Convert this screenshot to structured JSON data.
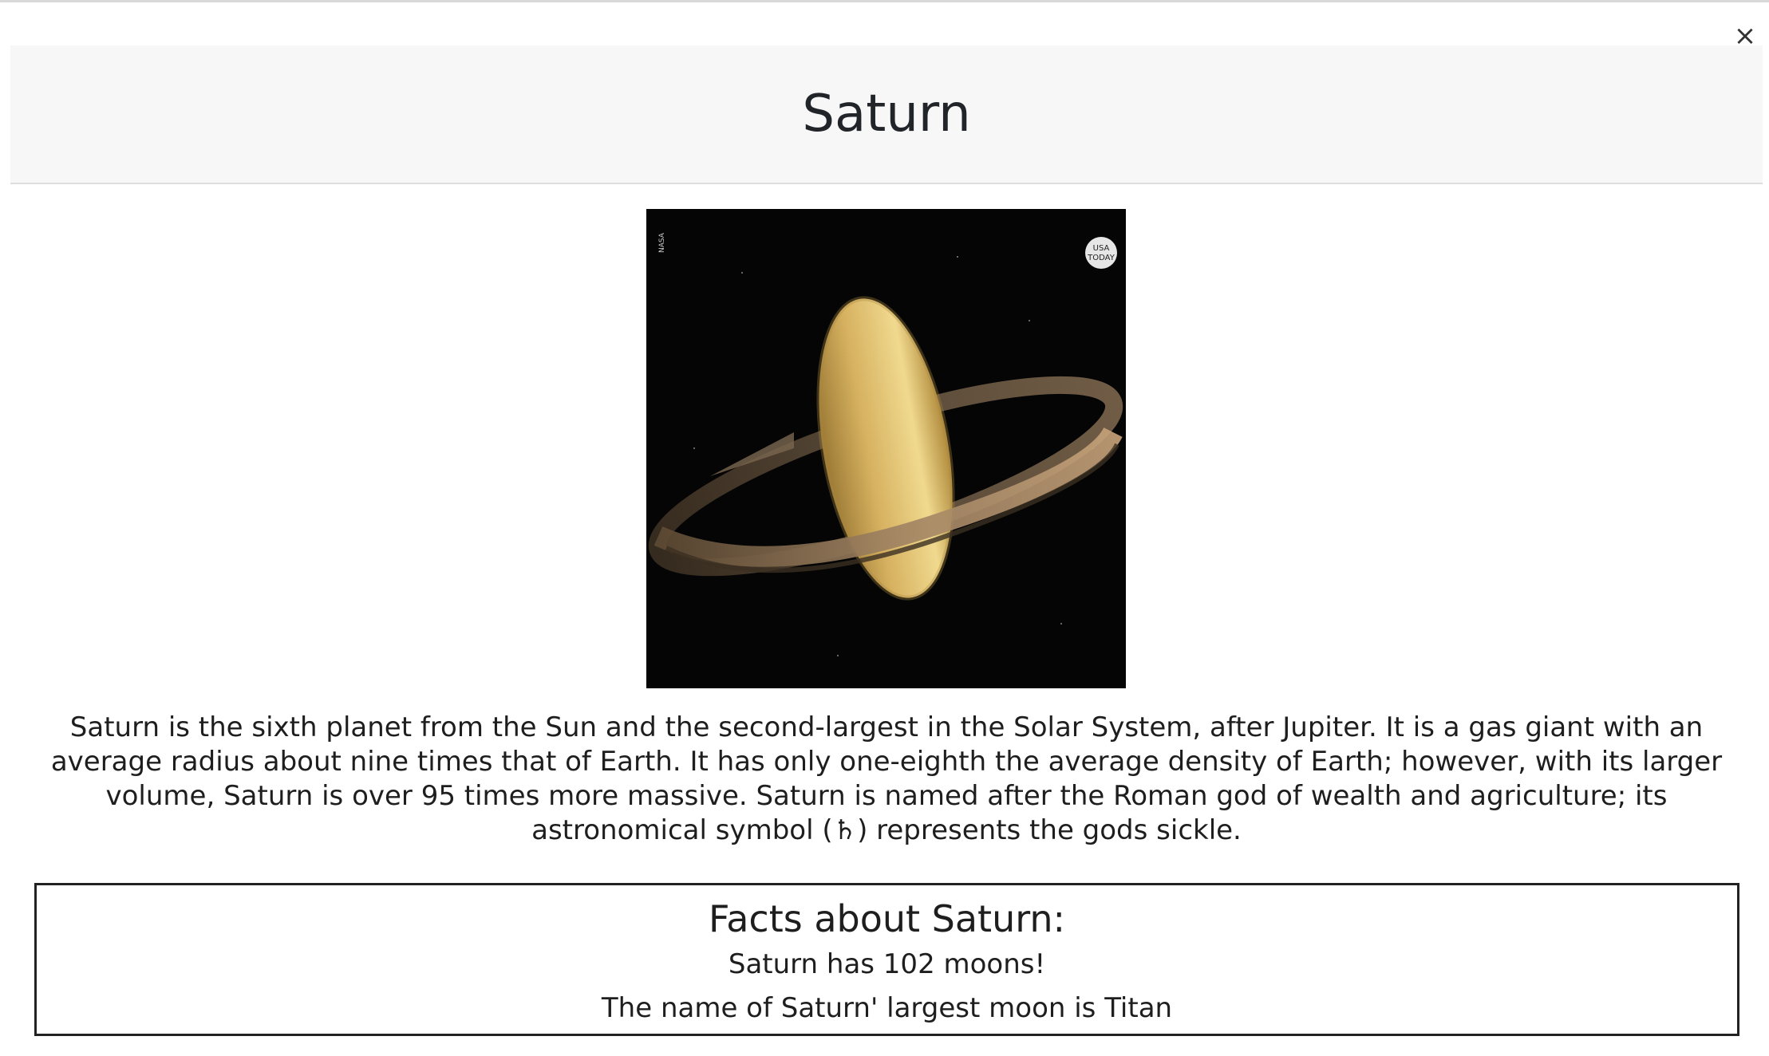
{
  "modal": {
    "close_label": "×",
    "title": "Saturn"
  },
  "image": {
    "alt": "Saturn",
    "watermark_left": "NASA",
    "badge_line1": "USA",
    "badge_line2": "TODAY"
  },
  "description": "Saturn is the sixth planet from the Sun and the second-largest in the Solar System, after Jupiter. It is a gas giant with an average radius about nine times that of Earth. It has only one-eighth the average density of Earth; however, with its larger volume, Saturn is over 95 times more massive. Saturn is named after the Roman god of wealth and agriculture; its astronomical symbol (♄) represents the gods sickle.",
  "facts": {
    "title": "Facts about Saturn:",
    "items": [
      "Saturn has 102 moons!",
      "The name of Saturn' largest moon is Titan"
    ]
  },
  "colors": {
    "header_bg": "#f7f7f7",
    "image_bg": "#050505",
    "planet": "#d8b35a",
    "rings": "#8a7456"
  },
  "icons": {
    "close": "close-icon"
  }
}
